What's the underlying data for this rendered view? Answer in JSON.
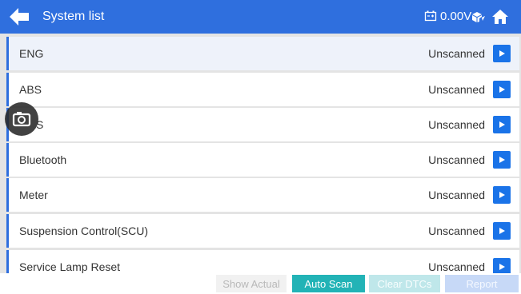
{
  "header": {
    "title": "System list",
    "voltage": "0.00V",
    "icons": {
      "back": "back-arrow-icon",
      "battery": "battery-icon",
      "vci": "vci-connection-icon",
      "home": "home-icon"
    },
    "background_color": "#2f6fde"
  },
  "systems": [
    {
      "label": "ENG",
      "status": "Unscanned",
      "selected": true
    },
    {
      "label": "ABS",
      "status": "Unscanned",
      "selected": false
    },
    {
      "label": "S",
      "status": "Unscanned",
      "selected": false
    },
    {
      "label": "Bluetooth",
      "status": "Unscanned",
      "selected": false
    },
    {
      "label": "Meter",
      "status": "Unscanned",
      "selected": false
    },
    {
      "label": "Suspension Control(SCU)",
      "status": "Unscanned",
      "selected": false
    },
    {
      "label": "Service Lamp Reset",
      "status": "Unscanned",
      "selected": false
    }
  ],
  "overlay": {
    "icon": "camera-icon"
  },
  "footer": {
    "show_actual": "Show Actual",
    "auto_scan": "Auto Scan",
    "clear_dtcs": "Clear DTCs",
    "report": "Report"
  },
  "colors": {
    "accent": "#2f6fde",
    "go_button": "#1a73e8",
    "auto_scan": "#22b3b6"
  }
}
